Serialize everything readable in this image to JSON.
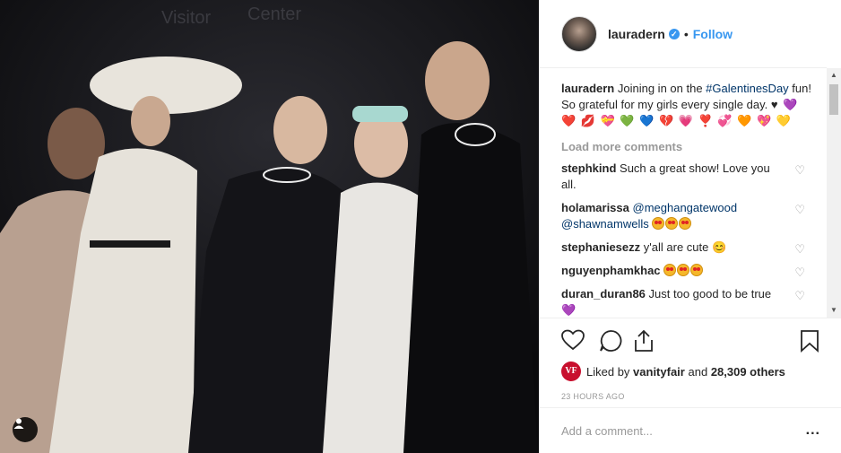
{
  "post": {
    "username": "lauradern",
    "follow_label": "Follow",
    "separator": "•",
    "caption_text": "Joining in on the ",
    "caption_tag": "#GalentinesDay",
    "caption_rest": " fun! So grateful for my girls every single day.",
    "caption_emoji": "♥ 💜 ❤️ 💋 💝 💚 💙 💔 💗 ❣️ 💞 🧡 💖 💛",
    "load_more": "Load more comments"
  },
  "comments": [
    {
      "user": "stephkind",
      "text": "Such a great show! Love you all."
    },
    {
      "user": "holamarissa",
      "mentions": "@meghangatewood @shawnamwells",
      "emoji_count": 3
    },
    {
      "user": "stephaniesezz",
      "text": "y'all are cute 😊"
    },
    {
      "user": "nguyenphamkhac",
      "emoji_count": 3
    },
    {
      "user": "duran_duran86",
      "text": "Just too good to be true 💜"
    }
  ],
  "likes": {
    "prefix": "Liked by",
    "liker": "vanityfair",
    "conj": "and",
    "count": "28,309 others",
    "badge": "VF"
  },
  "timestamp": "23 HOURS AGO",
  "add_comment": {
    "placeholder": "Add a comment...",
    "more": "..."
  },
  "photo_sign": "Center",
  "photo_sign_left": "Visitor",
  "colors": {
    "link": "#3897f0",
    "hashtag": "#003569",
    "muted": "#999999"
  }
}
